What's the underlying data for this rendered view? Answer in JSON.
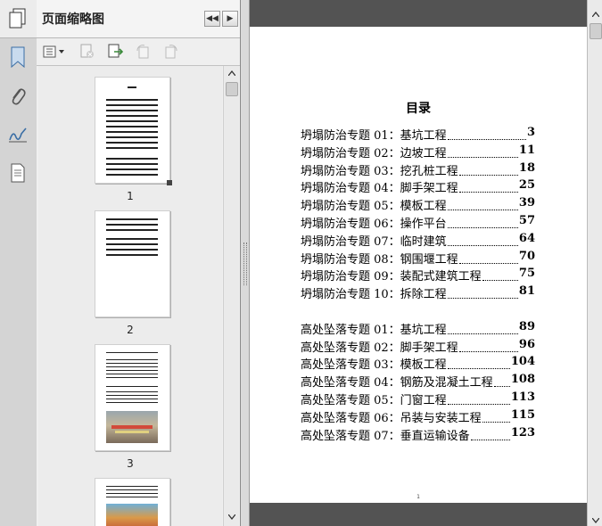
{
  "panel": {
    "title": "页面缩略图"
  },
  "thumbnails": [
    {
      "label": "1"
    },
    {
      "label": "2"
    },
    {
      "label": "3"
    }
  ],
  "document": {
    "title": "目录",
    "toc": [
      {
        "label": "坍塌防治专题 01：基坑工程",
        "page": "3"
      },
      {
        "label": "坍塌防治专题 02：边坡工程",
        "page": "11"
      },
      {
        "label": "坍塌防治专题 03：挖孔桩工程",
        "page": "18"
      },
      {
        "label": "坍塌防治专题 04：脚手架工程",
        "page": "25"
      },
      {
        "label": "坍塌防治专题 05：模板工程",
        "page": "39"
      },
      {
        "label": "坍塌防治专题 06：操作平台",
        "page": "57"
      },
      {
        "label": "坍塌防治专题 07：临时建筑",
        "page": "64"
      },
      {
        "label": "坍塌防治专题 08：钢围堰工程",
        "page": "70"
      },
      {
        "label": "坍塌防治专题 09：装配式建筑工程",
        "page": "75"
      },
      {
        "label": "坍塌防治专题 10：拆除工程",
        "page": "81"
      },
      {
        "label": "高处坠落专题 01：基坑工程",
        "page": "89"
      },
      {
        "label": "高处坠落专题 02：脚手架工程",
        "page": "96"
      },
      {
        "label": "高处坠落专题 03：模板工程",
        "page": "104"
      },
      {
        "label": "高处坠落专题 04：钢筋及混凝土工程",
        "page": "108"
      },
      {
        "label": "高处坠落专题 05：门窗工程",
        "page": "113"
      },
      {
        "label": "高处坠落专题 06：吊装与安装工程",
        "page": "115"
      },
      {
        "label": "高处坠落专题 07：垂直运输设备",
        "page": "123"
      }
    ],
    "footer_page": "1"
  },
  "icons": {
    "pages": "pages-icon",
    "bookmark": "bookmark-icon",
    "attachment": "paperclip-icon",
    "signature": "signature-icon",
    "layers": "document-layers-icon"
  }
}
